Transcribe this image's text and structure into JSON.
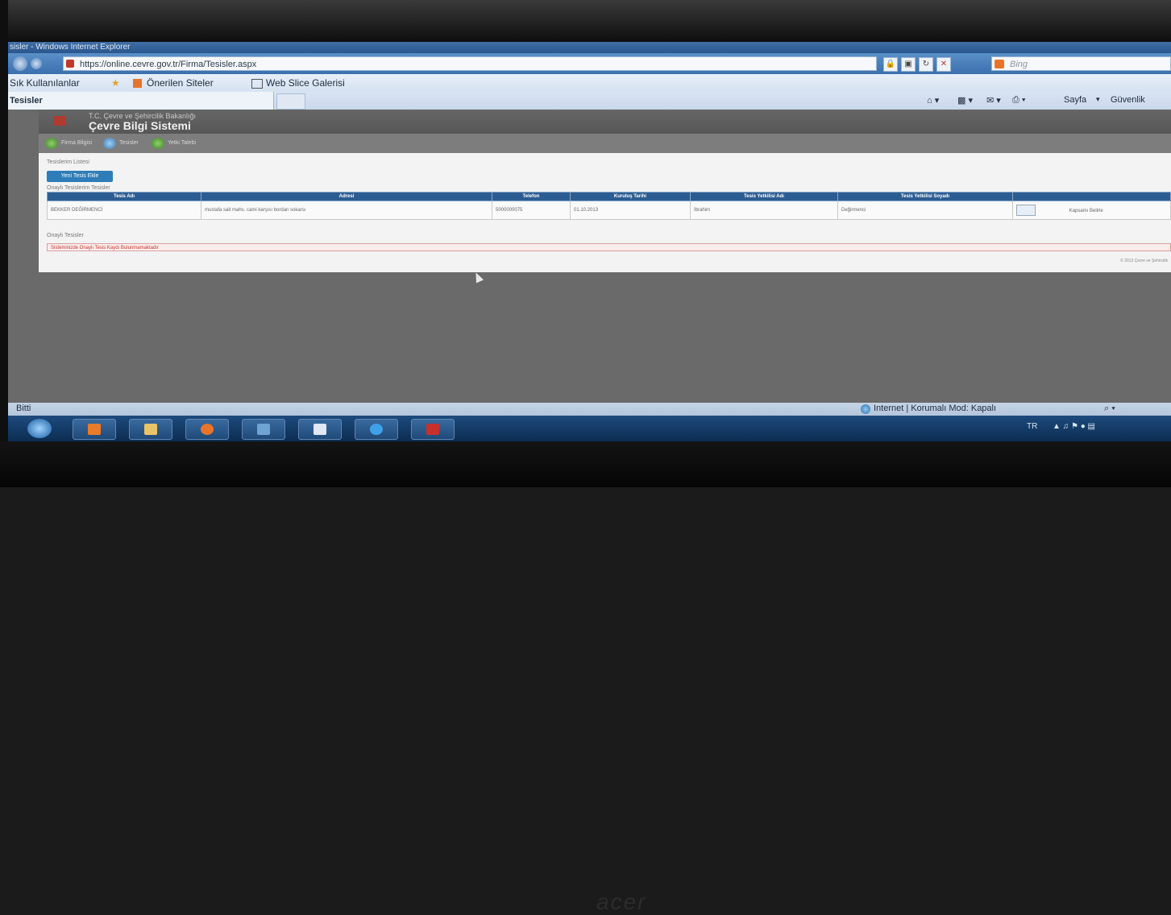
{
  "browser": {
    "window_title": "sisler - Windows Internet Explorer",
    "address_url": "https://online.cevre.gov.tr/Firma/Tesisler.aspx",
    "search_placeholder": "Bing",
    "favorites_label": "Sık Kullanılanlar",
    "suggested_sites": "Önerilen Siteler",
    "web_slice": "Web Slice Galerisi",
    "tab_title": "Tesisler",
    "cmd_page": "Sayfa",
    "cmd_security": "Güvenlik",
    "status_left": "Bitti",
    "status_zone": "Internet | Korumalı Mod: Kapalı"
  },
  "page": {
    "ministry": "T.C. Çevre ve Şehircilik Bakanlığı",
    "system_title": "Çevre Bilgi Sistemi",
    "nav": [
      "Firma Bilgisi",
      "Tesisler",
      "Yetki Talebi"
    ],
    "section_facilities": "Tesislerim Listesi",
    "new_facility_button": "Yeni Tesis Ekle",
    "approved_heading": "Onaylı Tesislerim Tesisler",
    "table_headers": [
      "Tesis Adı",
      "Adresi",
      "Telefon",
      "Kuruluş Tarihi",
      "Tesis Yetkilisi Adı",
      "Tesis Yetkilisi Soyadı",
      ""
    ],
    "rows": [
      [
        "BEKKER DEĞİRMENCİ",
        "mustafa sait mahs. cami karşısı bordan sokarsı",
        "5000000075",
        "01.10.2013",
        "İbrahim",
        "Değirmenci",
        "Kapsamı Belirle"
      ]
    ],
    "pending_heading": "Onaylı Tesisler",
    "warning": "Sisteminizde Onaylı Tesis Kaydı Bulunmamaktadır",
    "copyright": "© 2013 Çevre ve Şehircilik"
  },
  "taskbar": {
    "lang": "TR"
  },
  "monitor": {
    "brand": "acer"
  }
}
